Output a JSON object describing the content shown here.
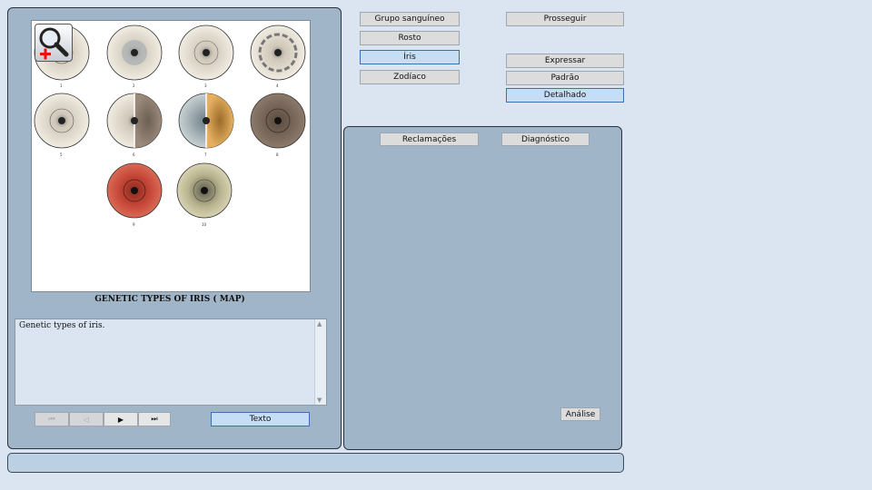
{
  "viewer": {
    "caption": "GENETIC TYPES OF IRIS ( MAP)",
    "description": "Genetic types of iris.",
    "zoom_icon": "magnifier-plus-icon",
    "iris_labels": [
      "1",
      "2",
      "3",
      "4",
      "5",
      "6",
      "7",
      "8",
      "9",
      "10"
    ]
  },
  "nav": {
    "first_icon": "⏮",
    "prev_icon": "◁",
    "next_icon": "▶",
    "last_icon": "⏭",
    "text_label": "Texto"
  },
  "categories": {
    "blood_group": "Grupo sanguíneo",
    "face": "Rosto",
    "iris": "Íris",
    "zodiac": "Zodíaco"
  },
  "actions": {
    "continue": "Prosseguir",
    "express": "Expressar",
    "standard": "Padrão",
    "detailed": "Detalhado"
  },
  "analysis": {
    "complaints_tab": "Reclamações",
    "diagnosis_tab": "Diagnóstico",
    "analysis_button": "Análise"
  },
  "status": {
    "text": ""
  },
  "colors": {
    "background": "#dbe5f1",
    "panel": "#a1b5c9",
    "active_button": "#c6def5",
    "active_border": "#3f6fae"
  }
}
